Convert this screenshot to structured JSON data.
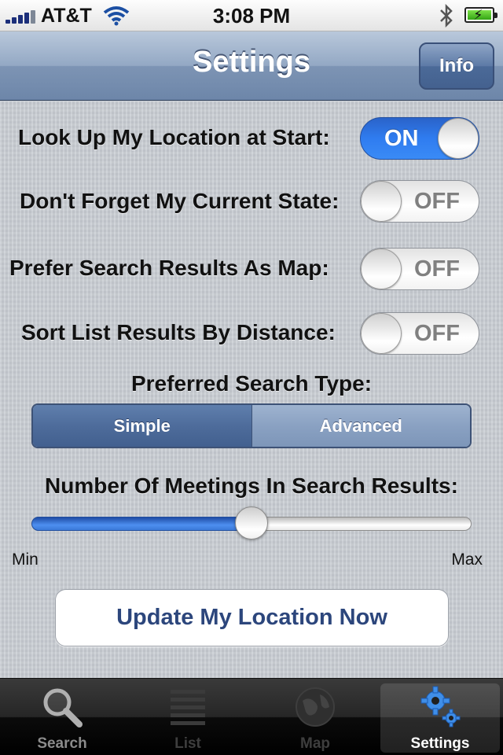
{
  "status_bar": {
    "carrier": "AT&T",
    "time": "3:08 PM",
    "signal_icon": "signal-bars-icon",
    "wifi_icon": "wifi-icon",
    "bluetooth_icon": "bluetooth-icon",
    "battery_icon": "battery-charging-icon",
    "battery_level": 1.0
  },
  "nav": {
    "title": "Settings",
    "info_label": "Info"
  },
  "settings": {
    "toggles": [
      {
        "label": "Look Up My Location at Start:",
        "state": "ON",
        "on": true
      },
      {
        "label": "Don't Forget My Current State:",
        "state": "OFF",
        "on": false
      },
      {
        "label": "Prefer Search Results As Map:",
        "state": "OFF",
        "on": false
      },
      {
        "label": "Sort List Results By Distance:",
        "state": "OFF",
        "on": false
      }
    ],
    "search_type": {
      "label": "Preferred Search Type:",
      "options": [
        "Simple",
        "Advanced"
      ],
      "selected": "Simple"
    },
    "meetings": {
      "label": "Number Of Meetings In Search Results:",
      "min_label": "Min",
      "max_label": "Max",
      "value_fraction": 0.5
    },
    "update_button_label": "Update My Location Now"
  },
  "tab_bar": {
    "tabs": [
      {
        "label": "Search",
        "icon": "magnifying-glass-icon",
        "state": "normal"
      },
      {
        "label": "List",
        "icon": "list-icon",
        "state": "disabled"
      },
      {
        "label": "Map",
        "icon": "globe-icon",
        "state": "disabled"
      },
      {
        "label": "Settings",
        "icon": "gears-icon",
        "state": "active"
      }
    ]
  },
  "colors": {
    "accent_blue": "#2f7cf0",
    "nav_blue": "#7d94b4",
    "button_text": "#2c467c"
  }
}
